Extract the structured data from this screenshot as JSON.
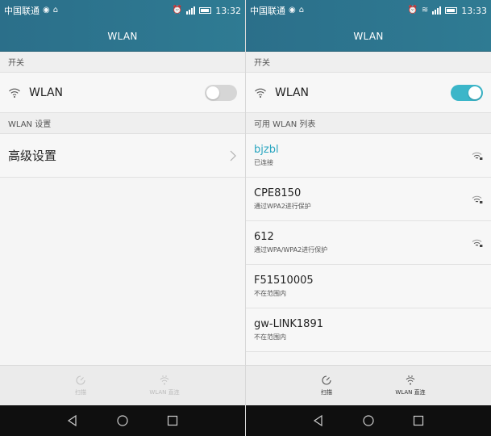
{
  "left": {
    "status": {
      "carrier": "中国联通",
      "time": "13:32"
    },
    "header": {
      "title": "WLAN"
    },
    "section_switch": "开关",
    "wlan_toggle": {
      "label": "WLAN",
      "state": "off"
    },
    "section_settings": "WLAN 设置",
    "advanced": {
      "label": "高级设置"
    },
    "bottom": {
      "scan": "扫描",
      "direct": "WLAN 直连"
    }
  },
  "right": {
    "status": {
      "carrier": "中国联通",
      "time": "13:33"
    },
    "header": {
      "title": "WLAN"
    },
    "section_switch": "开关",
    "wlan_toggle": {
      "label": "WLAN",
      "state": "on"
    },
    "section_list": "可用 WLAN 列表",
    "networks": [
      {
        "name": "bjzbl",
        "status": "已连接",
        "connected": true,
        "signal": "secured"
      },
      {
        "name": "CPE8150",
        "status": "通过WPA2进行保护",
        "connected": false,
        "signal": "secured"
      },
      {
        "name": "612",
        "status": "通过WPA/WPA2进行保护",
        "connected": false,
        "signal": "secured"
      },
      {
        "name": "F51510005",
        "status": "不在范围内",
        "connected": false,
        "signal": "none"
      },
      {
        "name": "gw-LINK1891",
        "status": "不在范围内",
        "connected": false,
        "signal": "none"
      }
    ],
    "bottom": {
      "scan": "扫描",
      "direct": "WLAN 直连"
    }
  },
  "colors": {
    "header": "#2b6f8a",
    "accent": "#3bb6c9",
    "connected_text": "#2aa6c0",
    "navbar": "#0f0f0f"
  },
  "icons": [
    "wifi-icon",
    "chevron-right-icon",
    "wifi-signal-icon",
    "scan-icon",
    "wlan-direct-icon",
    "back-icon",
    "home-icon",
    "recents-icon",
    "alarm-icon",
    "battery-icon",
    "signal-icon"
  ]
}
